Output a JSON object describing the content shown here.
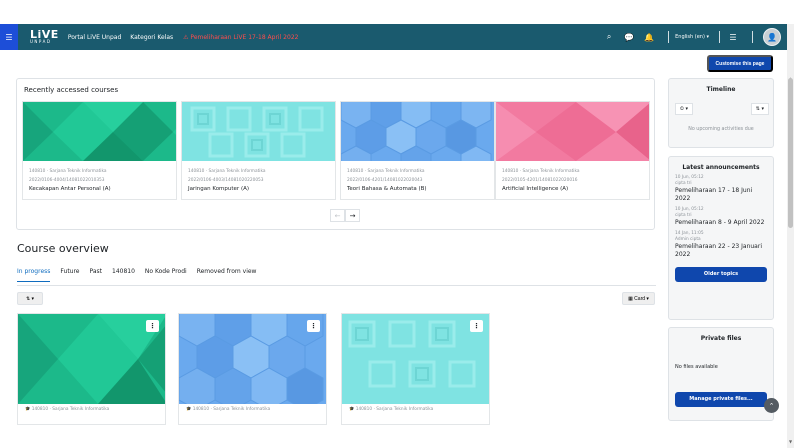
{
  "navbar": {
    "logo_big": "LiVE",
    "logo_small": "UNPAD",
    "links": [
      "Portal LiVE Unpad",
      "Kategori Kelas"
    ],
    "alert": "⚠ Pemeliharaan LiVE 17-18 April 2022",
    "language": "English (en) ▾"
  },
  "page": {
    "customise_label": "Customise this page"
  },
  "recent": {
    "title": "Recently accessed courses",
    "courses": [
      {
        "category": "140810 · Sarjana Teknik Informatika",
        "code": "2022/0106-4004/14081022010353",
        "name": "Kecakapan Antar Personal (A)",
        "color": "green"
      },
      {
        "category": "140810 · Sarjana Teknik Informatika",
        "code": "2022/0106-4003/14081020220053",
        "name": "Jaringan Komputer (A)",
        "color": "cyan"
      },
      {
        "category": "140810 · Sarjana Teknik Informatika",
        "code": "2022/0106-4201/14081022020043",
        "name": "Teori Bahasa & Automata (B)",
        "color": "blue"
      },
      {
        "category": "140810 · Sarjana Teknik Informatika",
        "code": "2022/0105-4201/14081022020016",
        "name": "Artificial Intelligence (A)",
        "color": "pink"
      }
    ],
    "prev": "←",
    "next": "→"
  },
  "overview": {
    "title": "Course overview",
    "tabs": [
      "In progress",
      "Future",
      "Past",
      "140810",
      "No Kode Prodi",
      "Removed from view"
    ],
    "sort_label": "⇅ ▾",
    "view_label": "▦ Card ▾",
    "cards": [
      {
        "category": "🎓 140810 · Sarjana Teknik Informatika",
        "color": "green"
      },
      {
        "category": "🎓 140810 · Sarjana Teknik Informatika",
        "color": "blue"
      },
      {
        "category": "🎓 140810 · Sarjana Teknik Informatika",
        "color": "cyan"
      }
    ]
  },
  "timeline": {
    "title": "Timeline",
    "filter_label": "⏲ ▾",
    "sort_label": "⇅ ▾",
    "empty": "No upcoming activities due"
  },
  "announcements": {
    "title": "Latest announcements",
    "items": [
      {
        "date": "10 Jun, 05:12",
        "author": "cipta tri",
        "title": "Pemeliharaan 17 - 18 Juni 2022"
      },
      {
        "date": "10 Jun, 05:12",
        "author": "cipta tri",
        "title": "Pemeliharaan 8 - 9 April 2022"
      },
      {
        "date": "14 Jan, 11:05",
        "author": "Admin cipta",
        "title": "Pemeliharaan 22 - 23 Januari 2022"
      }
    ],
    "older_label": "Older topics"
  },
  "private_files": {
    "title": "Private files",
    "empty": "No files available",
    "manage_label": "Manage private files..."
  },
  "colors": {
    "navbar": "#1a5a6e",
    "primary": "#0f47ad",
    "green": "#1cb98a",
    "cyan": "#7fe3e2",
    "blue": "#6aa9ee",
    "pink": "#f27aa0"
  }
}
